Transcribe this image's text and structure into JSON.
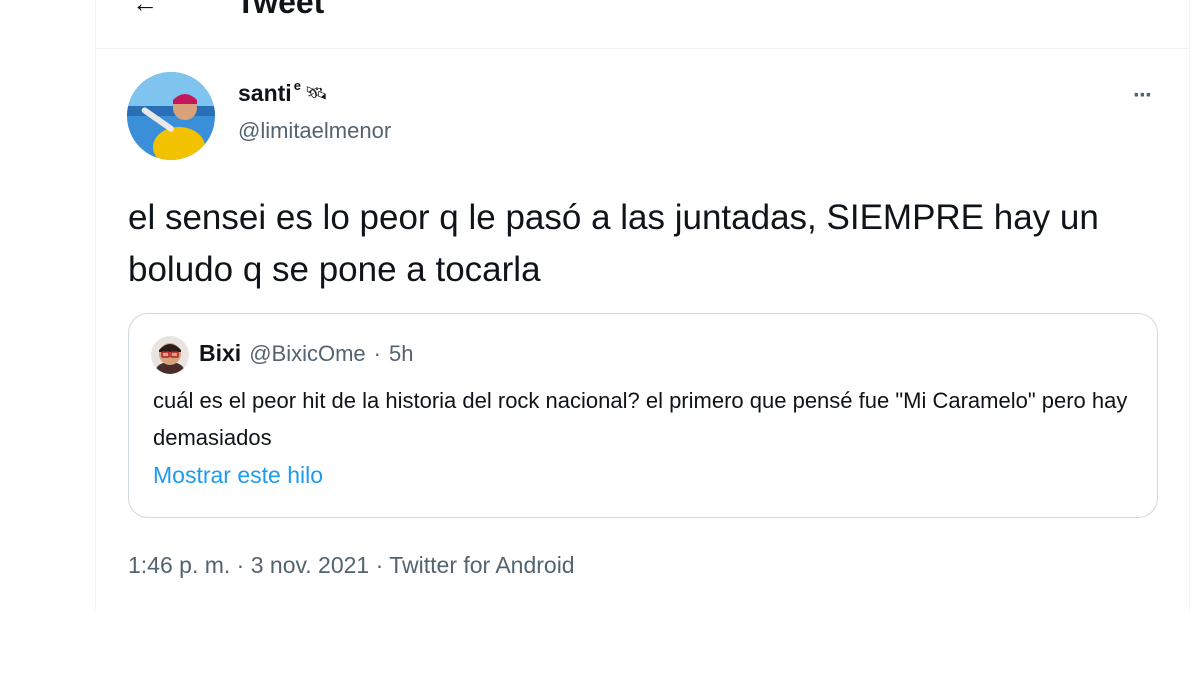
{
  "header": {
    "title": "Tweet",
    "back_icon": "arrow-left-icon"
  },
  "author": {
    "display_name": "santi",
    "name_superscript": "e",
    "name_emoji": "🛰",
    "handle": "@limitaelmenor"
  },
  "more_icon": "more-horizontal-icon",
  "more_glyph": "···",
  "tweet": {
    "text": "el sensei es lo peor q le pasó a las juntadas, SIEMPRE hay un boludo q se pone a tocarla"
  },
  "quoted_tweet": {
    "name": "Bixi",
    "handle": "@BixicOme",
    "separator": "·",
    "time": "5h",
    "text": "cuál es el peor hit de la historia del rock nacional? el primero que pensé fue \"Mi Caramelo\" pero hay demasiados",
    "show_thread_label": "Mostrar este hilo"
  },
  "meta": {
    "timestamp_line": "1:46 p. m. · 3 nov. 2021 · Twitter for Android"
  },
  "colors": {
    "text_primary": "#0f1419",
    "text_secondary": "#536471",
    "link": "#1d9bf0",
    "border": "#cfd9de"
  }
}
